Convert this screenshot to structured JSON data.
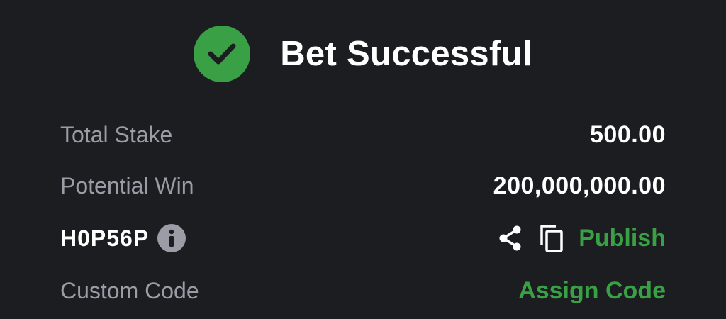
{
  "header": {
    "icon": "check-circle-icon",
    "title": "Bet Successful",
    "accent_color": "#3aa046"
  },
  "summary": {
    "total_stake": {
      "label": "Total Stake",
      "value": "500.00"
    },
    "potential_win": {
      "label": "Potential Win",
      "value": "200,000,000.00"
    }
  },
  "booking": {
    "code": "H0P56P",
    "info_icon": "info-icon",
    "share_icon": "share-icon",
    "copy_icon": "copy-icon",
    "publish_label": "Publish"
  },
  "custom_code": {
    "label": "Custom Code",
    "action_label": "Assign Code"
  }
}
